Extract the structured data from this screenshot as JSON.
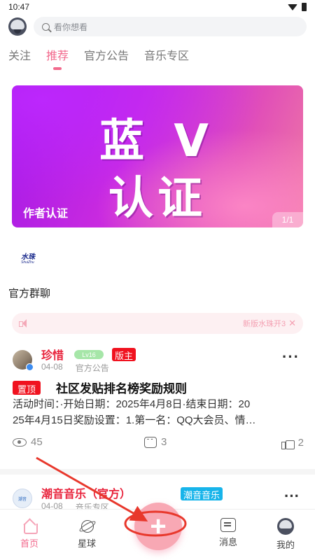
{
  "status_bar": {
    "time": "10:47"
  },
  "search": {
    "placeholder": "看你想看"
  },
  "tabs": [
    {
      "label": "关注"
    },
    {
      "label": "推荐",
      "active": true
    },
    {
      "label": "官方公告"
    },
    {
      "label": "音乐专区"
    }
  ],
  "banner": {
    "line1": "蓝 V",
    "line2": "认证",
    "caption": "作者认证",
    "counter": "1/1"
  },
  "shuizhu_logo": {
    "main": "水珠",
    "sub": "ShuiZhu"
  },
  "group_chat_title": "官方群聊",
  "notice": {
    "text": "新版水珠开3"
  },
  "post": {
    "author": "珍惜",
    "level": "Lv16",
    "mod_badge": "版主",
    "date": "04-08",
    "category": "官方公告",
    "pin_label": "置顶",
    "title": "社区发贴排名榜奖励规则",
    "body_line1": "活动时间：·开始日期：2025年4月8日·结束日期：20",
    "body_line2": "25年4月15日奖励设置：1.第一名：QQ大会员、情…",
    "views": "45",
    "comments": "3",
    "likes": "2"
  },
  "post2": {
    "author": "潮音音乐（官方）",
    "tag": "潮音音乐",
    "date": "04-08",
    "category": "音乐专区"
  },
  "bottom_nav": [
    {
      "label": "首页",
      "icon": "home-icon",
      "active": true
    },
    {
      "label": "星球",
      "icon": "planet-icon"
    },
    {
      "label": "消息",
      "icon": "message-icon"
    },
    {
      "label": "我的",
      "icon": "profile-icon"
    }
  ],
  "fab_symbol": "+",
  "colors": {
    "accent": "#f26a8d",
    "author_red": "#e8223b",
    "pin_red": "#f0121f",
    "music_tag": "#17b4ea",
    "annotation": "#e8382c"
  }
}
